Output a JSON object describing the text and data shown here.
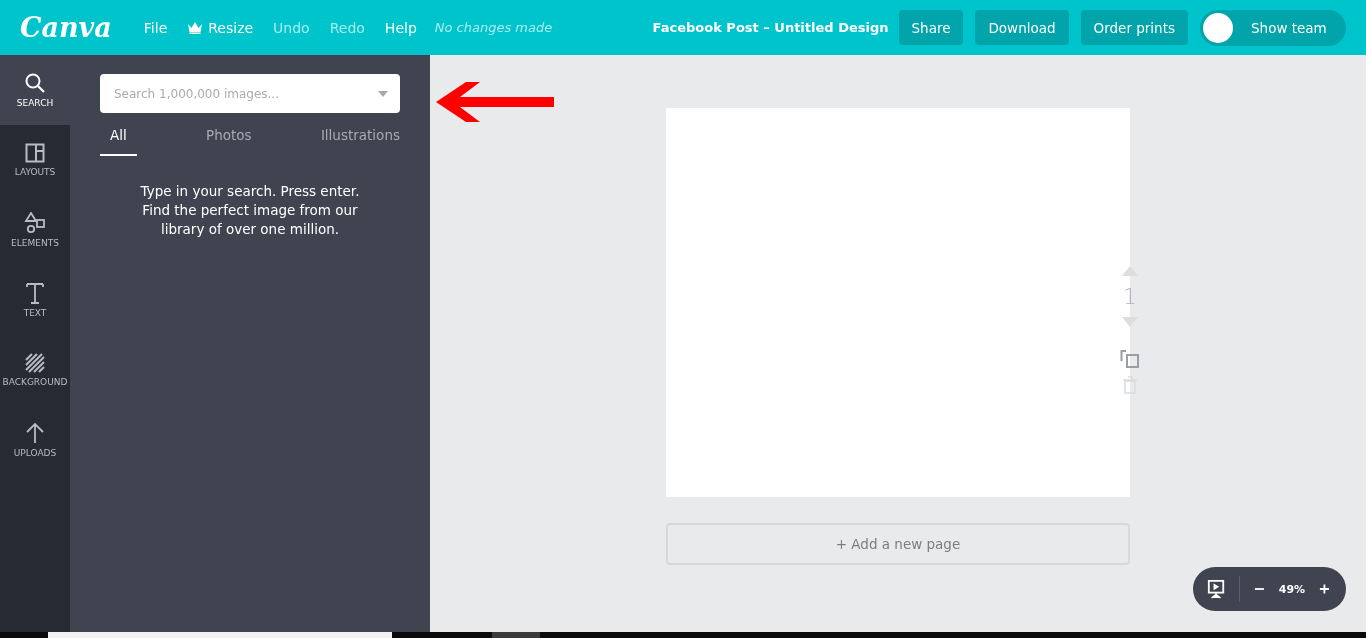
{
  "header": {
    "logo": "Canva",
    "menu": [
      {
        "label": "File",
        "disabled": false,
        "kind": "plain"
      },
      {
        "label": "Resize",
        "disabled": false,
        "kind": "crown"
      },
      {
        "label": "Undo",
        "disabled": true,
        "kind": "plain"
      },
      {
        "label": "Redo",
        "disabled": true,
        "kind": "plain"
      },
      {
        "label": "Help",
        "disabled": false,
        "kind": "plain"
      }
    ],
    "status": "No changes made",
    "title": "Facebook Post – Untitled Design",
    "buttons": [
      "Share",
      "Download",
      "Order prints"
    ],
    "team_toggle": {
      "label": "Show team",
      "on": false
    }
  },
  "sidebar": {
    "items": [
      {
        "label": "SEARCH",
        "kind": "search",
        "selected": true
      },
      {
        "label": "LAYOUTS",
        "kind": "layouts",
        "selected": false
      },
      {
        "label": "ELEMENTS",
        "kind": "elements",
        "selected": false
      },
      {
        "label": "TEXT",
        "kind": "text",
        "selected": false
      },
      {
        "label": "BACKGROUND",
        "kind": "background",
        "selected": false
      },
      {
        "label": "UPLOADS",
        "kind": "uploads",
        "selected": false
      }
    ]
  },
  "panel": {
    "search": {
      "placeholder": "Search 1,000,000 images..."
    },
    "tabs": [
      {
        "label": "All",
        "selected": true
      },
      {
        "label": "Photos",
        "selected": false
      },
      {
        "label": "Illustrations",
        "selected": false
      }
    ],
    "hint": "Type in your search. Press enter. Find the perfect image from our library of over one million."
  },
  "editor": {
    "page_number": "1",
    "add_page": "+ Add a new page",
    "zoom": "49%"
  }
}
